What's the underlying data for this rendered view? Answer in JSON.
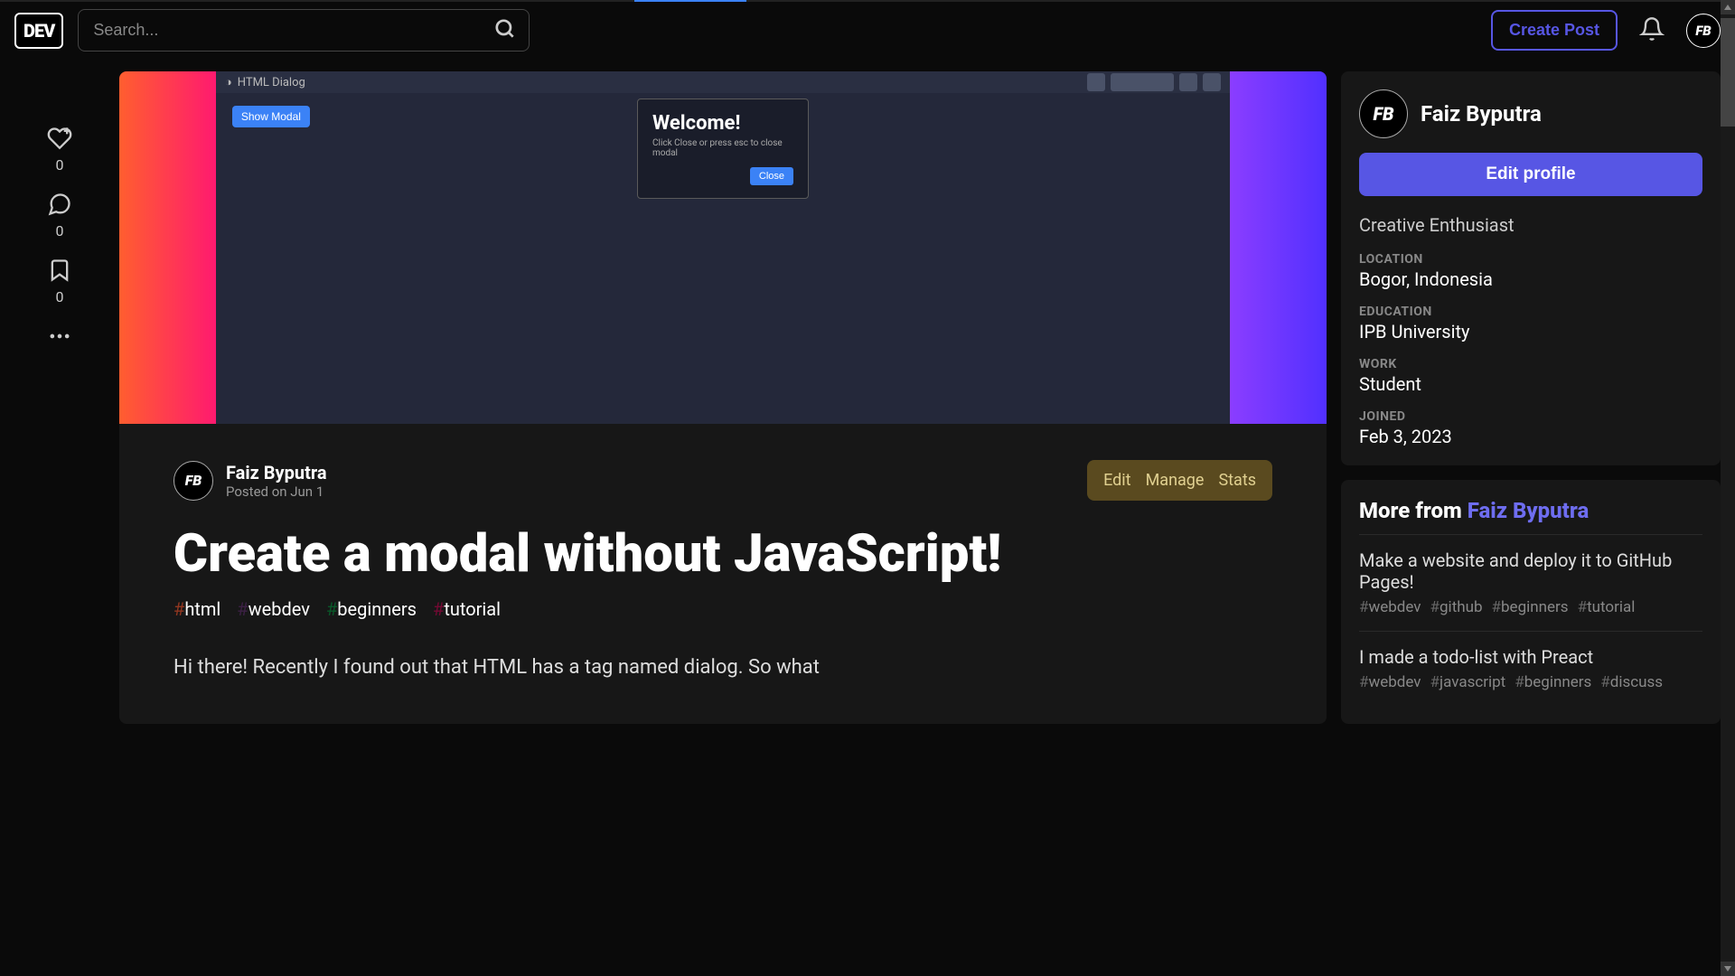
{
  "header": {
    "logo": "DEV",
    "search_placeholder": "Search...",
    "create_post": "Create Post",
    "avatar_initials": "FB"
  },
  "reactions": {
    "like_count": "0",
    "comment_count": "0",
    "bookmark_count": "0"
  },
  "cover": {
    "header_text": "HTML Dialog",
    "show_modal": "Show Modal",
    "dialog_title": "Welcome!",
    "dialog_text": "Click Close or press esc to close modal",
    "dialog_close": "Close"
  },
  "article": {
    "author": "Faiz Byputra",
    "author_initials": "FB",
    "date": "Posted on Jun 1",
    "actions": {
      "edit": "Edit",
      "manage": "Manage",
      "stats": "Stats"
    },
    "title": "Create a modal without JavaScript!",
    "tags": [
      {
        "name": "html",
        "cls": "hash-html"
      },
      {
        "name": "webdev",
        "cls": "hash-webdev"
      },
      {
        "name": "beginners",
        "cls": "hash-beginners"
      },
      {
        "name": "tutorial",
        "cls": "hash-tutorial"
      }
    ],
    "body": "Hi there! Recently I found out that HTML has a tag named dialog. So what"
  },
  "profile": {
    "name": "Faiz Byputra",
    "initials": "FB",
    "edit": "Edit profile",
    "bio": "Creative Enthusiast",
    "location_label": "LOCATION",
    "location": "Bogor, Indonesia",
    "education_label": "EDUCATION",
    "education": "IPB University",
    "work_label": "WORK",
    "work": "Student",
    "joined_label": "JOINED",
    "joined": "Feb 3, 2023"
  },
  "more": {
    "heading_prefix": "More from ",
    "heading_name": "Faiz Byputra",
    "items": [
      {
        "title": "Make a website and deploy it to GitHub Pages!",
        "tags": [
          "webdev",
          "github",
          "beginners",
          "tutorial"
        ]
      },
      {
        "title": "I made a todo-list with Preact",
        "tags": [
          "webdev",
          "javascript",
          "beginners",
          "discuss"
        ]
      }
    ]
  }
}
